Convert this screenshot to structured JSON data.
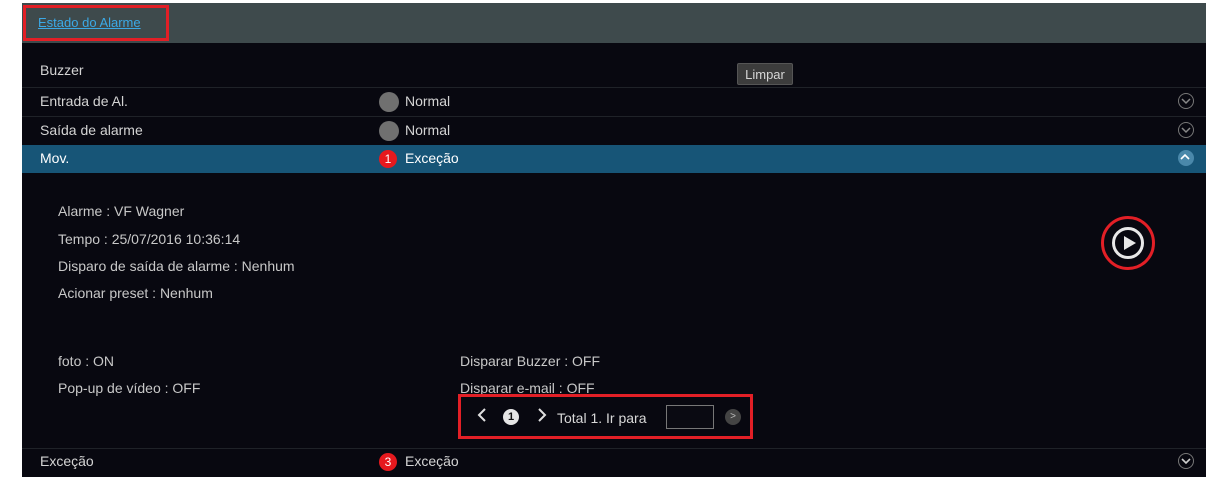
{
  "header": {
    "title": "Estado do Alarme"
  },
  "toolbar": {
    "clear_label": "Limpar"
  },
  "rows": [
    {
      "label": "Buzzer",
      "status": ""
    },
    {
      "label": "Entrada de Al.",
      "status": "Normal"
    },
    {
      "label": "Saída de alarme",
      "status": "Normal"
    },
    {
      "label": "Mov.",
      "status": "Exceção",
      "badge": "1"
    },
    {
      "label": "Exceção",
      "status": "Exceção",
      "badge": "3"
    }
  ],
  "details": {
    "alarm": "Alarme : VF Wagner",
    "time": "Tempo : 25/07/2016 10:36:14",
    "trigger_output": "Disparo de saída de alarme : Nenhum",
    "preset": "Acionar preset : Nenhum",
    "photo": "foto : ON",
    "popup": "Pop-up de vídeo : OFF",
    "buzzer": "Disparar Buzzer : OFF",
    "email": "Disparar e-mail : OFF"
  },
  "pager": {
    "prev_icon": "chevron-left-icon",
    "page": "1",
    "next_icon": "chevron-right-icon",
    "total_text": "Total 1. Ir para",
    "jump_value": "",
    "go_icon": "go-icon"
  },
  "colors": {
    "accent": "#175577",
    "alert": "#e6191e",
    "link": "#3ba9e6"
  }
}
